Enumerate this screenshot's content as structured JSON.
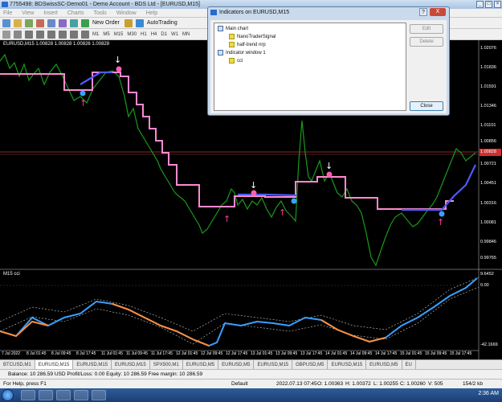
{
  "window": {
    "title": "7755498: BDSwissSC-Demo01 - Demo Account - BDS Ltd - [EURUSD,M15]",
    "controls": [
      "_",
      "□",
      "×"
    ]
  },
  "menu": [
    "File",
    "View",
    "Insert",
    "Charts",
    "Tools",
    "Window",
    "Help"
  ],
  "toolbar": {
    "new_order_label": "New Order",
    "autotrading_label": "AutoTrading",
    "timeframes": [
      "M1",
      "M5",
      "M15",
      "M30",
      "H1",
      "H4",
      "D1",
      "W1",
      "MN"
    ]
  },
  "chart": {
    "header": "EURUSD,M15  1.00828 1.00828 1.00826 1.00828",
    "price_labels": [
      "1.02076",
      "1.01836",
      "1.01591",
      "1.01346",
      "1.01101",
      "1.00856",
      "1.00828",
      "1.00721",
      "1.00451",
      "1.00316",
      "1.00081",
      "0.99846",
      "0.99765"
    ],
    "current_price": "1.00828",
    "indicator_header": "M15 cci",
    "indicator_labels": [
      "9.6452",
      "0.00",
      "-42.1669"
    ],
    "time_labels": [
      "7 Jul 2022",
      "8 Jul 01:45",
      "8 Jul 09:45",
      "8 Jul 17:45",
      "11 Jul 01:45",
      "11 Jul 09:45",
      "11 Jul 17:45",
      "12 Jul 01:45",
      "12 Jul 09:45",
      "12 Jul 17:45",
      "13 Jul 01:45",
      "13 Jul 09:45",
      "13 Jul 17:45",
      "14 Jul 01:45",
      "14 Jul 09:45",
      "14 Jul 17:45",
      "15 Jul 01:45",
      "15 Jul 09:45",
      "15 Jul 17:45"
    ]
  },
  "tabs": [
    "BTCUSD,M1",
    "EURUSD,M15",
    "EURUSD,M15",
    "EURUSD,M15",
    "SPX500,M1",
    "EURUSD,M5",
    "EURUSD,M5",
    "EURUSD,M15",
    "GBPUSD,M5",
    "EURUSD,M15",
    "EURUSD,M5",
    "EU"
  ],
  "balance_line": "Balance: 10 286.59 USD  Profit/Loss: 0.00  Equity: 10 286.59  Free margin: 10 286.59",
  "status": {
    "help": "For Help, press F1",
    "profile": "Default",
    "datetime": "2022.07.13 07:45",
    "open": "O: 1.00363",
    "high": "H: 1.00372",
    "low": "L: 1.00255",
    "close": "C: 1.00260",
    "volume": "V: 505",
    "traffic": "154/2 kb"
  },
  "taskbar": {
    "time": "2:36 AM"
  },
  "dialog": {
    "title": "Indicators on EURUSD,M15",
    "help": "?",
    "close": "X",
    "tree": {
      "main": "Main chart",
      "ind1": "NanoTraderSignal",
      "ind2": "half-trend nrp",
      "win": "Indicator window 1",
      "ind3": "cci"
    },
    "edit_label": "Edit",
    "delete_label": "Delete",
    "close_label": "Close"
  }
}
